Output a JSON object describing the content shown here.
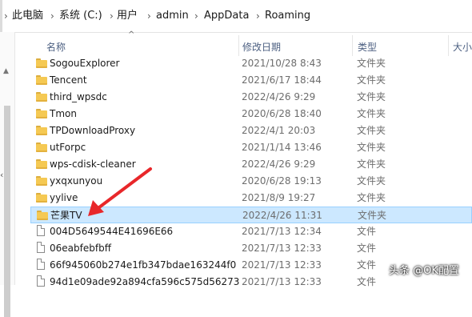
{
  "breadcrumb": [
    "此电脑",
    "系统 (C:)",
    "用户",
    "admin",
    "AppData",
    "Roaming"
  ],
  "columns": {
    "name": "名称",
    "modified": "修改日期",
    "type": "类型",
    "size": "大小"
  },
  "rows": [
    {
      "name": "SogouExplorer",
      "date": "2021/10/28 8:43",
      "type": "文件夹",
      "icon": "folder-icon"
    },
    {
      "name": "Tencent",
      "date": "2021/6/17 18:44",
      "type": "文件夹",
      "icon": "folder-icon"
    },
    {
      "name": "third_wpsdc",
      "date": "2022/4/26 9:29",
      "type": "文件夹",
      "icon": "folder-icon"
    },
    {
      "name": "Tmon",
      "date": "2020/6/28 18:40",
      "type": "文件夹",
      "icon": "folder-icon"
    },
    {
      "name": "TPDownloadProxy",
      "date": "2022/4/1 20:03",
      "type": "文件夹",
      "icon": "folder-icon"
    },
    {
      "name": "utForpc",
      "date": "2021/1/14 13:46",
      "type": "文件夹",
      "icon": "folder-icon"
    },
    {
      "name": "wps-cdisk-cleaner",
      "date": "2022/4/26 9:29",
      "type": "文件夹",
      "icon": "folder-icon"
    },
    {
      "name": "yxqxunyou",
      "date": "2020/6/28 19:13",
      "type": "文件夹",
      "icon": "folder-icon"
    },
    {
      "name": "yylive",
      "date": "2021/8/9 19:27",
      "type": "文件夹",
      "icon": "folder-icon"
    },
    {
      "name": "芒果TV",
      "date": "2022/4/26 11:31",
      "type": "文件夹",
      "icon": "folder-icon",
      "selected": true
    },
    {
      "name": "004D5649544E41696E66",
      "date": "2021/7/13 12:34",
      "type": "文件",
      "icon": "file-icon"
    },
    {
      "name": "06eabfebfbff",
      "date": "2021/7/13 12:33",
      "type": "文件",
      "icon": "file-icon"
    },
    {
      "name": "66f945060b274e1fb347bdae163244f0",
      "date": "2021/7/13 12:33",
      "type": "文件",
      "icon": "file-icon"
    },
    {
      "name": "94d1e09ade92a894cfa596c575d56273",
      "date": "2021/7/13 12:33",
      "type": "文件",
      "icon": "file-icon"
    }
  ],
  "watermark": "头条 @OK配置",
  "colors": {
    "selection": "#cce8ff",
    "selection_border": "#99d1ff",
    "folder": "#f5c953",
    "arrow": "#e8272a"
  }
}
